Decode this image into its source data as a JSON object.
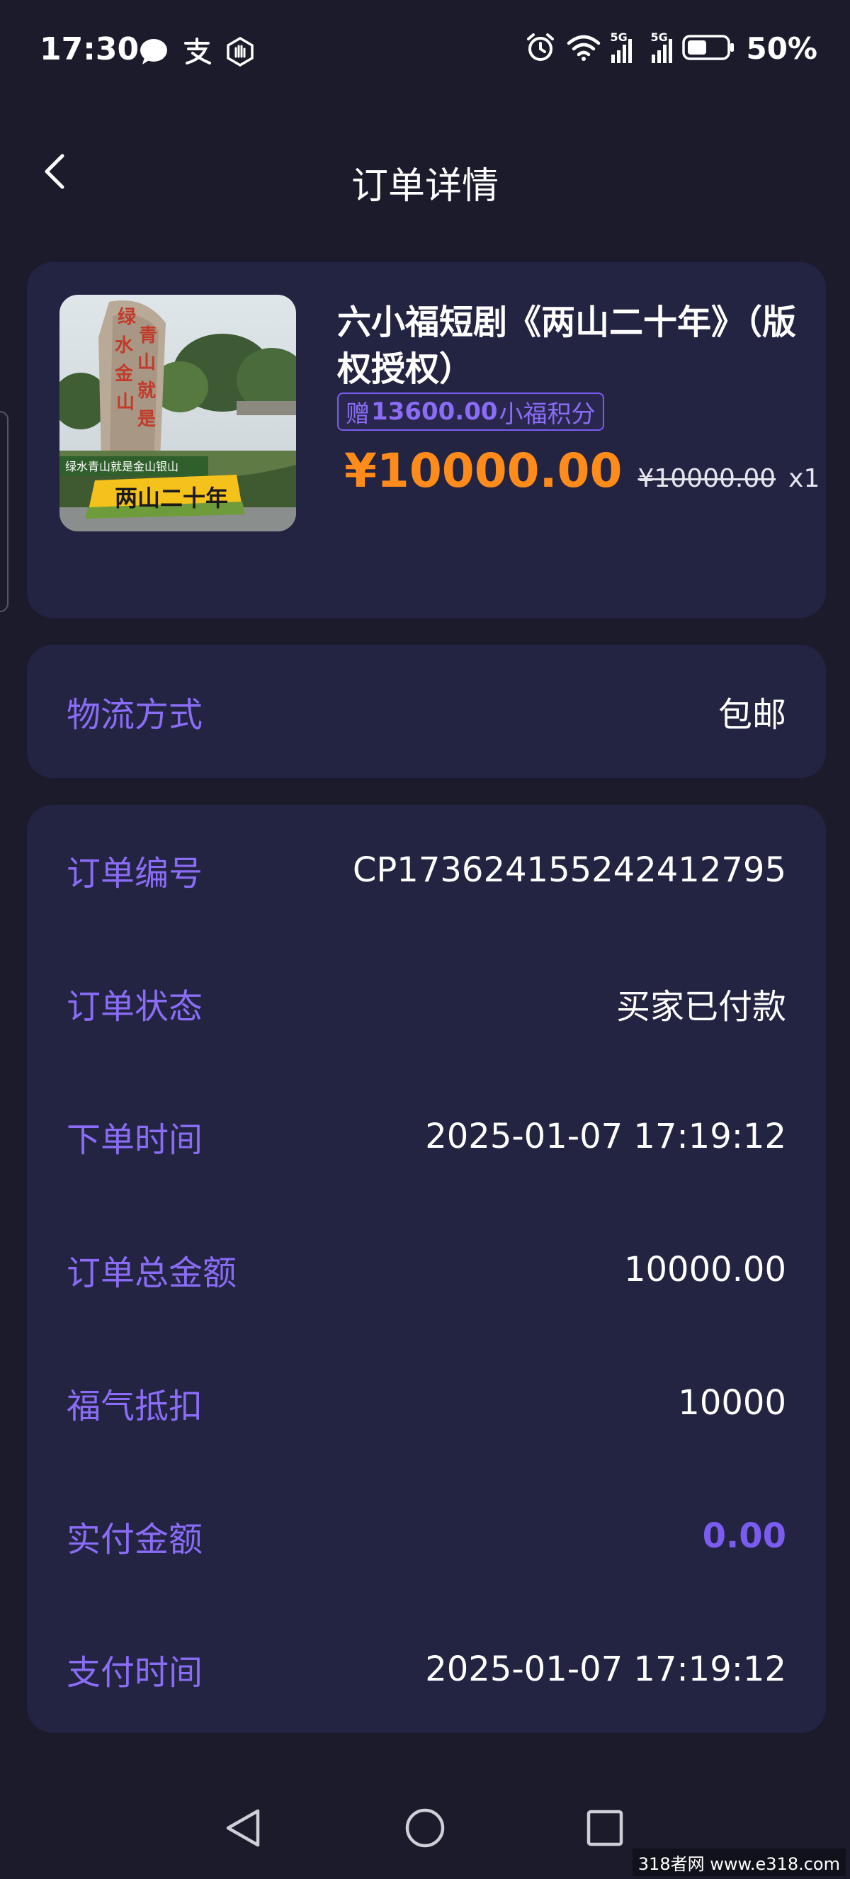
{
  "status_bar": {
    "time": "17:30",
    "battery": "50%",
    "network_1": "5G",
    "network_2": "5G",
    "icons_left": [
      "message-icon",
      "alipay-icon",
      "hand-shield-icon"
    ],
    "icons_right": [
      "alarm-icon",
      "wifi-icon",
      "signal-icon",
      "signal-icon",
      "battery-icon"
    ]
  },
  "header": {
    "title": "订单详情",
    "back_icon": "chevron-left-icon"
  },
  "product": {
    "name": "六小福短剧《两山二十年》（版权授权）",
    "bonus_prefix": "赠",
    "bonus_amount": "13600.00",
    "bonus_suffix": "小福积分",
    "price": "¥10000.00",
    "original_price": "¥10000.00",
    "quantity": "x1",
    "thumb_caption": "两山二十年",
    "thumb_subcaption": "绿水青山就是金山银山"
  },
  "logistics": {
    "label": "物流方式",
    "value": "包邮"
  },
  "order_info": [
    {
      "label": "订单编号",
      "value": "CP17362415524241279​5"
    },
    {
      "label": "订单状态",
      "value": "买家已付款"
    },
    {
      "label": "下单时间",
      "value": "2025-01-07 17:19:12"
    },
    {
      "label": "订单总金额",
      "value": "10000.00"
    },
    {
      "label": "福气抵扣",
      "value": "10000"
    },
    {
      "label": "实付金额",
      "value": "0.00"
    },
    {
      "label": "支付时间",
      "value": "2025-01-07 17:19:12"
    }
  ],
  "nav": {
    "back": "triangle-back-icon",
    "home": "circle-home-icon",
    "recents": "square-recents-icon"
  },
  "watermark": "318者网 www.e318.com",
  "colors": {
    "background": "#1b1b2b",
    "card": "#232342",
    "accent_purple": "#7b5cf0",
    "label_purple": "#8a6cf6",
    "price_orange": "#ff8c1a"
  }
}
